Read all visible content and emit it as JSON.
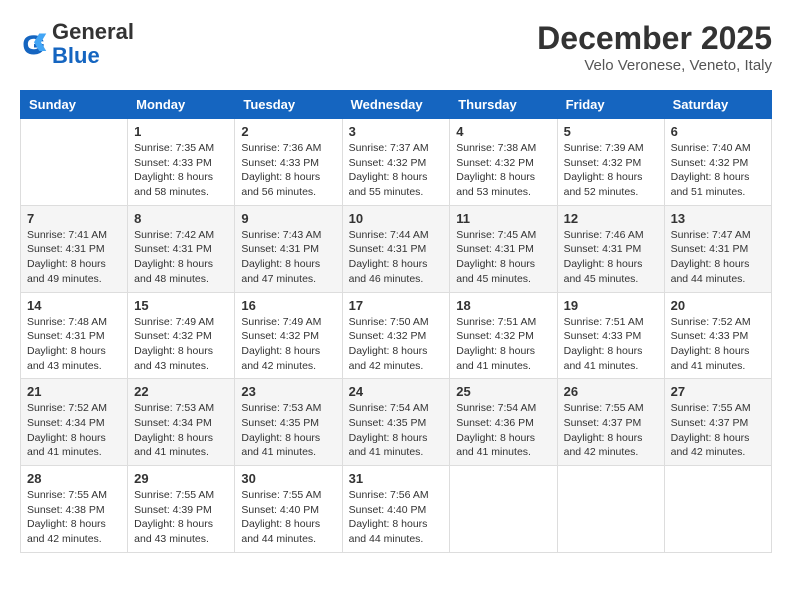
{
  "header": {
    "logo_line1": "General",
    "logo_line2": "Blue",
    "month": "December 2025",
    "location": "Velo Veronese, Veneto, Italy"
  },
  "days_of_week": [
    "Sunday",
    "Monday",
    "Tuesday",
    "Wednesday",
    "Thursday",
    "Friday",
    "Saturday"
  ],
  "weeks": [
    [
      {
        "day": "",
        "info": ""
      },
      {
        "day": "1",
        "info": "Sunrise: 7:35 AM\nSunset: 4:33 PM\nDaylight: 8 hours\nand 58 minutes."
      },
      {
        "day": "2",
        "info": "Sunrise: 7:36 AM\nSunset: 4:33 PM\nDaylight: 8 hours\nand 56 minutes."
      },
      {
        "day": "3",
        "info": "Sunrise: 7:37 AM\nSunset: 4:32 PM\nDaylight: 8 hours\nand 55 minutes."
      },
      {
        "day": "4",
        "info": "Sunrise: 7:38 AM\nSunset: 4:32 PM\nDaylight: 8 hours\nand 53 minutes."
      },
      {
        "day": "5",
        "info": "Sunrise: 7:39 AM\nSunset: 4:32 PM\nDaylight: 8 hours\nand 52 minutes."
      },
      {
        "day": "6",
        "info": "Sunrise: 7:40 AM\nSunset: 4:32 PM\nDaylight: 8 hours\nand 51 minutes."
      }
    ],
    [
      {
        "day": "7",
        "info": "Sunrise: 7:41 AM\nSunset: 4:31 PM\nDaylight: 8 hours\nand 49 minutes."
      },
      {
        "day": "8",
        "info": "Sunrise: 7:42 AM\nSunset: 4:31 PM\nDaylight: 8 hours\nand 48 minutes."
      },
      {
        "day": "9",
        "info": "Sunrise: 7:43 AM\nSunset: 4:31 PM\nDaylight: 8 hours\nand 47 minutes."
      },
      {
        "day": "10",
        "info": "Sunrise: 7:44 AM\nSunset: 4:31 PM\nDaylight: 8 hours\nand 46 minutes."
      },
      {
        "day": "11",
        "info": "Sunrise: 7:45 AM\nSunset: 4:31 PM\nDaylight: 8 hours\nand 45 minutes."
      },
      {
        "day": "12",
        "info": "Sunrise: 7:46 AM\nSunset: 4:31 PM\nDaylight: 8 hours\nand 45 minutes."
      },
      {
        "day": "13",
        "info": "Sunrise: 7:47 AM\nSunset: 4:31 PM\nDaylight: 8 hours\nand 44 minutes."
      }
    ],
    [
      {
        "day": "14",
        "info": "Sunrise: 7:48 AM\nSunset: 4:31 PM\nDaylight: 8 hours\nand 43 minutes."
      },
      {
        "day": "15",
        "info": "Sunrise: 7:49 AM\nSunset: 4:32 PM\nDaylight: 8 hours\nand 43 minutes."
      },
      {
        "day": "16",
        "info": "Sunrise: 7:49 AM\nSunset: 4:32 PM\nDaylight: 8 hours\nand 42 minutes."
      },
      {
        "day": "17",
        "info": "Sunrise: 7:50 AM\nSunset: 4:32 PM\nDaylight: 8 hours\nand 42 minutes."
      },
      {
        "day": "18",
        "info": "Sunrise: 7:51 AM\nSunset: 4:32 PM\nDaylight: 8 hours\nand 41 minutes."
      },
      {
        "day": "19",
        "info": "Sunrise: 7:51 AM\nSunset: 4:33 PM\nDaylight: 8 hours\nand 41 minutes."
      },
      {
        "day": "20",
        "info": "Sunrise: 7:52 AM\nSunset: 4:33 PM\nDaylight: 8 hours\nand 41 minutes."
      }
    ],
    [
      {
        "day": "21",
        "info": "Sunrise: 7:52 AM\nSunset: 4:34 PM\nDaylight: 8 hours\nand 41 minutes."
      },
      {
        "day": "22",
        "info": "Sunrise: 7:53 AM\nSunset: 4:34 PM\nDaylight: 8 hours\nand 41 minutes."
      },
      {
        "day": "23",
        "info": "Sunrise: 7:53 AM\nSunset: 4:35 PM\nDaylight: 8 hours\nand 41 minutes."
      },
      {
        "day": "24",
        "info": "Sunrise: 7:54 AM\nSunset: 4:35 PM\nDaylight: 8 hours\nand 41 minutes."
      },
      {
        "day": "25",
        "info": "Sunrise: 7:54 AM\nSunset: 4:36 PM\nDaylight: 8 hours\nand 41 minutes."
      },
      {
        "day": "26",
        "info": "Sunrise: 7:55 AM\nSunset: 4:37 PM\nDaylight: 8 hours\nand 42 minutes."
      },
      {
        "day": "27",
        "info": "Sunrise: 7:55 AM\nSunset: 4:37 PM\nDaylight: 8 hours\nand 42 minutes."
      }
    ],
    [
      {
        "day": "28",
        "info": "Sunrise: 7:55 AM\nSunset: 4:38 PM\nDaylight: 8 hours\nand 42 minutes."
      },
      {
        "day": "29",
        "info": "Sunrise: 7:55 AM\nSunset: 4:39 PM\nDaylight: 8 hours\nand 43 minutes."
      },
      {
        "day": "30",
        "info": "Sunrise: 7:55 AM\nSunset: 4:40 PM\nDaylight: 8 hours\nand 44 minutes."
      },
      {
        "day": "31",
        "info": "Sunrise: 7:56 AM\nSunset: 4:40 PM\nDaylight: 8 hours\nand 44 minutes."
      },
      {
        "day": "",
        "info": ""
      },
      {
        "day": "",
        "info": ""
      },
      {
        "day": "",
        "info": ""
      }
    ]
  ]
}
